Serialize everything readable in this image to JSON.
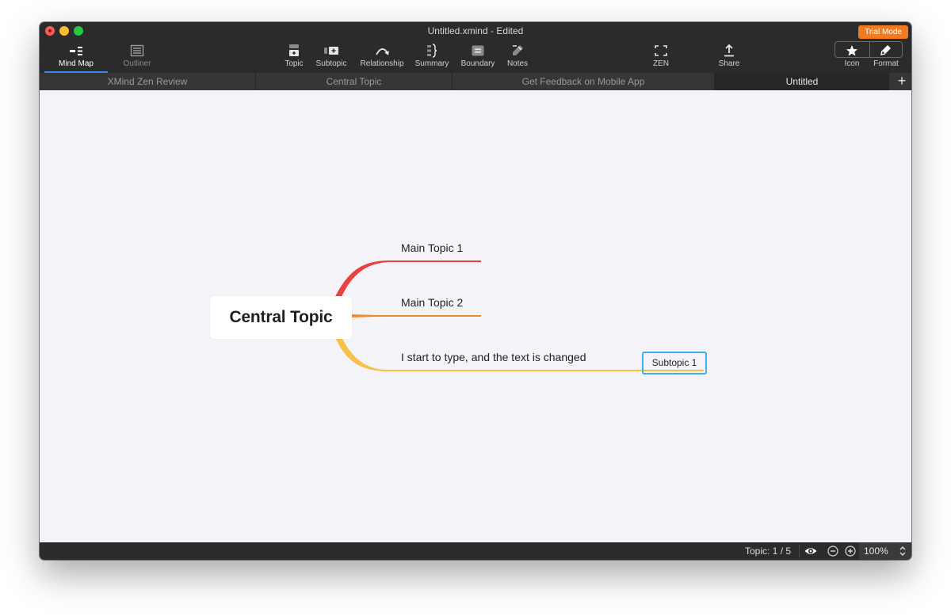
{
  "window": {
    "title": "Untitled.xmind - Edited",
    "trial_badge": "Trial Mode"
  },
  "toolbar": {
    "mind_map": "Mind Map",
    "outliner": "Outliner",
    "topic": "Topic",
    "subtopic": "Subtopic",
    "relationship": "Relationship",
    "summary": "Summary",
    "boundary": "Boundary",
    "notes": "Notes",
    "zen": "ZEN",
    "share": "Share",
    "icon": "Icon",
    "format": "Format"
  },
  "tabs": [
    {
      "label": "XMind Zen Review",
      "active": false
    },
    {
      "label": "Central Topic",
      "active": false
    },
    {
      "label": "Get Feedback on Mobile App",
      "active": false
    },
    {
      "label": "Untitled",
      "active": true
    }
  ],
  "mindmap": {
    "central_topic": "Central Topic",
    "main_topics": [
      {
        "label": "Main Topic 1",
        "color": "#e8423d"
      },
      {
        "label": "Main Topic 2",
        "color": "#f08a2e"
      },
      {
        "label": "I start to type, and the text is changed",
        "color": "#f7c04a"
      }
    ],
    "subtopic": {
      "label": "Subtopic 1",
      "selection_color": "#3daee9"
    }
  },
  "statusbar": {
    "topic_count": "Topic: 1 / 5",
    "zoom": "100%"
  },
  "icons": [
    "mind-map-icon",
    "outliner-icon",
    "topic-icon",
    "subtopic-icon",
    "relationship-icon",
    "summary-icon",
    "boundary-icon",
    "notes-icon",
    "zen-icon",
    "share-icon",
    "star-icon",
    "pen-icon",
    "add-tab-icon",
    "eye-icon",
    "zoom-out-icon",
    "zoom-in-icon",
    "chevron-updown-icon"
  ]
}
